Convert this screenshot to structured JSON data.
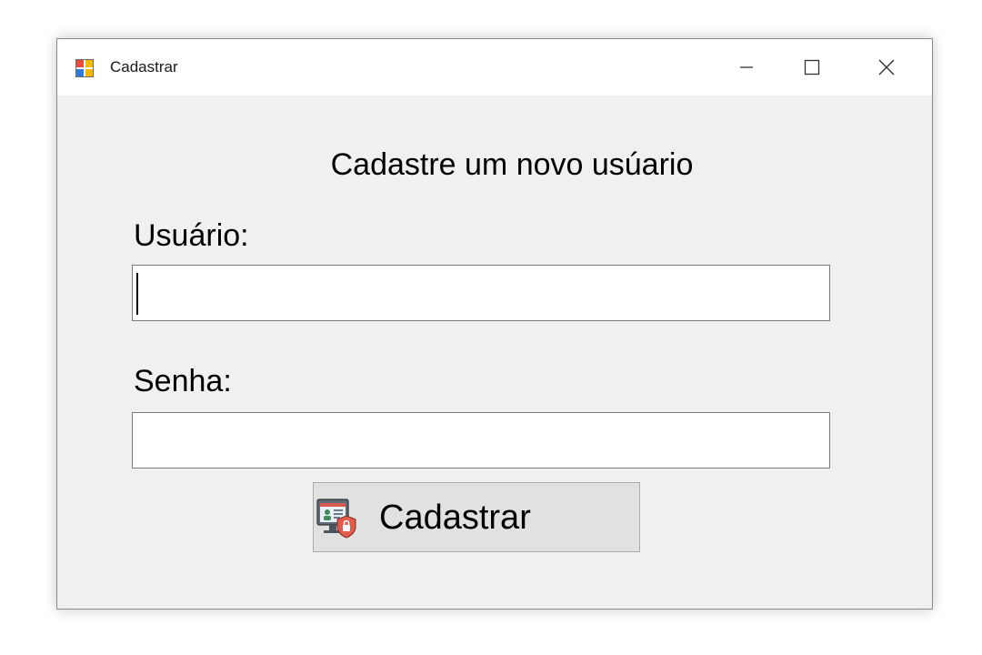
{
  "window": {
    "title": "Cadastrar",
    "icon": "windows-form-icon"
  },
  "caption_buttons": {
    "minimize_icon": "minimize-icon",
    "maximize_icon": "maximize-icon",
    "close_icon": "close-icon"
  },
  "form": {
    "heading": "Cadastre um novo usúario",
    "username_label": "Usuário:",
    "username_value": "",
    "password_label": "Senha:",
    "password_value": "",
    "submit_label": "Cadastrar",
    "submit_icon": "user-registration-icon"
  },
  "colors": {
    "window_background": "#f0f0f0",
    "titlebar_background": "#ffffff",
    "button_background": "#e1e1e1",
    "textbox_border": "#7a7a7a"
  }
}
